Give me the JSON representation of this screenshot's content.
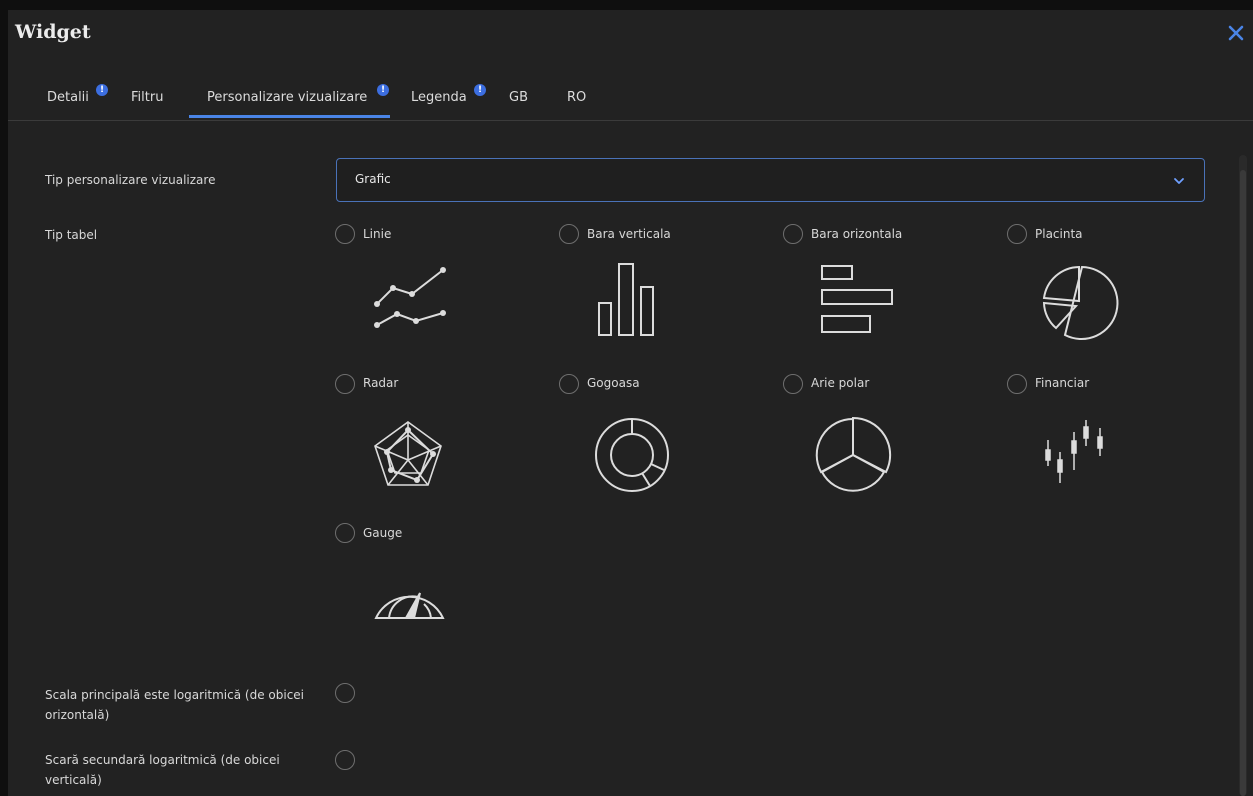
{
  "dialog": {
    "title": "Widget"
  },
  "tabs": [
    {
      "label": "Detalii",
      "badge": "!"
    },
    {
      "label": "Filtru"
    },
    {
      "label": "Personalizare vizualizare",
      "badge": "!"
    },
    {
      "label": "Legenda",
      "badge": "!"
    },
    {
      "label": "GB"
    },
    {
      "label": "RO"
    }
  ],
  "form": {
    "visualization_type": {
      "label": "Tip personalizare vizualizare",
      "value": "Grafic"
    },
    "table_type": {
      "label": "Tip tabel",
      "options": [
        {
          "label": "Linie",
          "icon": "line-chart-icon"
        },
        {
          "label": "Bara verticala",
          "icon": "vertical-bar-chart-icon"
        },
        {
          "label": "Bara orizontala",
          "icon": "horizontal-bar-chart-icon"
        },
        {
          "label": "Placinta",
          "icon": "pie-chart-icon"
        },
        {
          "label": "Radar",
          "icon": "radar-chart-icon"
        },
        {
          "label": "Gogoasa",
          "icon": "donut-chart-icon"
        },
        {
          "label": "Arie polar",
          "icon": "polar-area-chart-icon"
        },
        {
          "label": "Financiar",
          "icon": "financial-chart-icon"
        },
        {
          "label": "Gauge",
          "icon": "gauge-chart-icon"
        }
      ]
    },
    "primary_log_scale": {
      "label_line1": "Scala principală este logaritmică (de obicei",
      "label_line2": "orizontală)"
    },
    "secondary_log_scale": {
      "label_line1": "Scară secundară logaritmică (de obicei",
      "label_line2": "verticală)"
    }
  },
  "colors": {
    "accent": "#4a84e6",
    "badge": "#3c6ee0",
    "background": "#222222"
  }
}
